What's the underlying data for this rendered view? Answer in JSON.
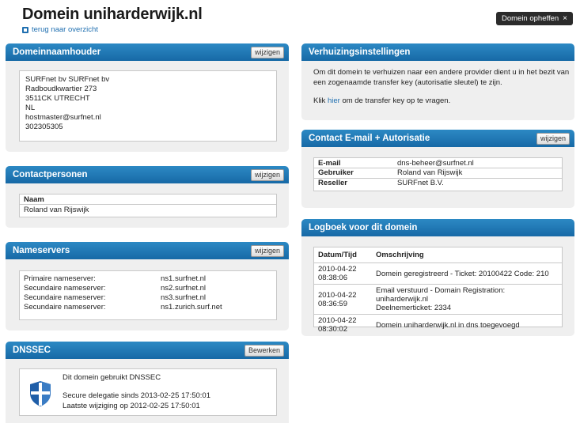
{
  "page": {
    "title": "Domein uniharderwijk.nl",
    "back_link": "terug naar overzicht",
    "cancel_button": "Domein opheffen",
    "cancel_button_x": "×"
  },
  "holder": {
    "title": "Domeinnaamhouder",
    "edit": "wijzigen",
    "lines": [
      "SURFnet bv SURFnet bv",
      "Radboudkwartier 273",
      "3511CK UTRECHT",
      "NL",
      "hostmaster@surfnet.nl",
      "302305305"
    ]
  },
  "contacts": {
    "title": "Contactpersonen",
    "edit": "wijzigen",
    "header": "Naam",
    "name": "Roland van Rijswijk"
  },
  "nameservers": {
    "title": "Nameservers",
    "edit": "wijzigen",
    "rows": [
      {
        "label": "Primaire nameserver:",
        "value": "ns1.surfnet.nl"
      },
      {
        "label": "Secundaire nameserver:",
        "value": "ns2.surfnet.nl"
      },
      {
        "label": "Secundaire nameserver:",
        "value": "ns3.surfnet.nl"
      },
      {
        "label": "Secundaire nameserver:",
        "value": "ns1.zurich.surf.net"
      }
    ]
  },
  "dnssec": {
    "title": "DNSSEC",
    "edit": "Bewerken",
    "status": "Dit domein gebruikt DNSSEC",
    "secure_since": "Secure delegatie sinds 2013-02-25 17:50:01",
    "last_change": "Laatste wijziging op 2012-02-25 17:50:01",
    "icon": "shield-icon"
  },
  "transfer": {
    "title": "Verhuizingsinstellingen",
    "text": "Om dit domein te verhuizen naar een andere provider dient u in het bezit van een zogenaamde transfer key (autorisatie sleutel) te zijn.",
    "klik": "Klik",
    "link": "hier",
    "after": "om de transfer key op te vragen."
  },
  "contact_email": {
    "title": "Contact E-mail + Autorisatie",
    "edit": "wijzigen",
    "rows": [
      {
        "key": "E-mail",
        "value": "dns-beheer@surfnet.nl"
      },
      {
        "key": "Gebruiker",
        "value": "Roland van Rijswijk"
      },
      {
        "key": "Reseller",
        "value": "SURFnet B.V."
      }
    ]
  },
  "log": {
    "title": "Logboek voor dit domein",
    "col_date": "Datum/Tijd",
    "col_desc": "Omschrijving",
    "rows": [
      {
        "date": "2010-04-22",
        "time": "08:38:06",
        "desc1": "Domein geregistreerd - Ticket: 20100422 Code: 210",
        "desc2": ""
      },
      {
        "date": "2010-04-22",
        "time": "08:36:59",
        "desc1": "Email verstuurd - Domain Registration: uniharderwijk.nl",
        "desc2": "Deelnemerticket: 2334"
      },
      {
        "date": "2010-04-22",
        "time": "08:30:02",
        "desc1": "Domein uniharderwijk.nl in dns toegevoegd",
        "desc2": ""
      }
    ]
  },
  "colors": {
    "accent": "#1769a6",
    "dark_button": "#2b2b2b",
    "panel_bg": "#efefef",
    "link": "#1f6fb0"
  }
}
